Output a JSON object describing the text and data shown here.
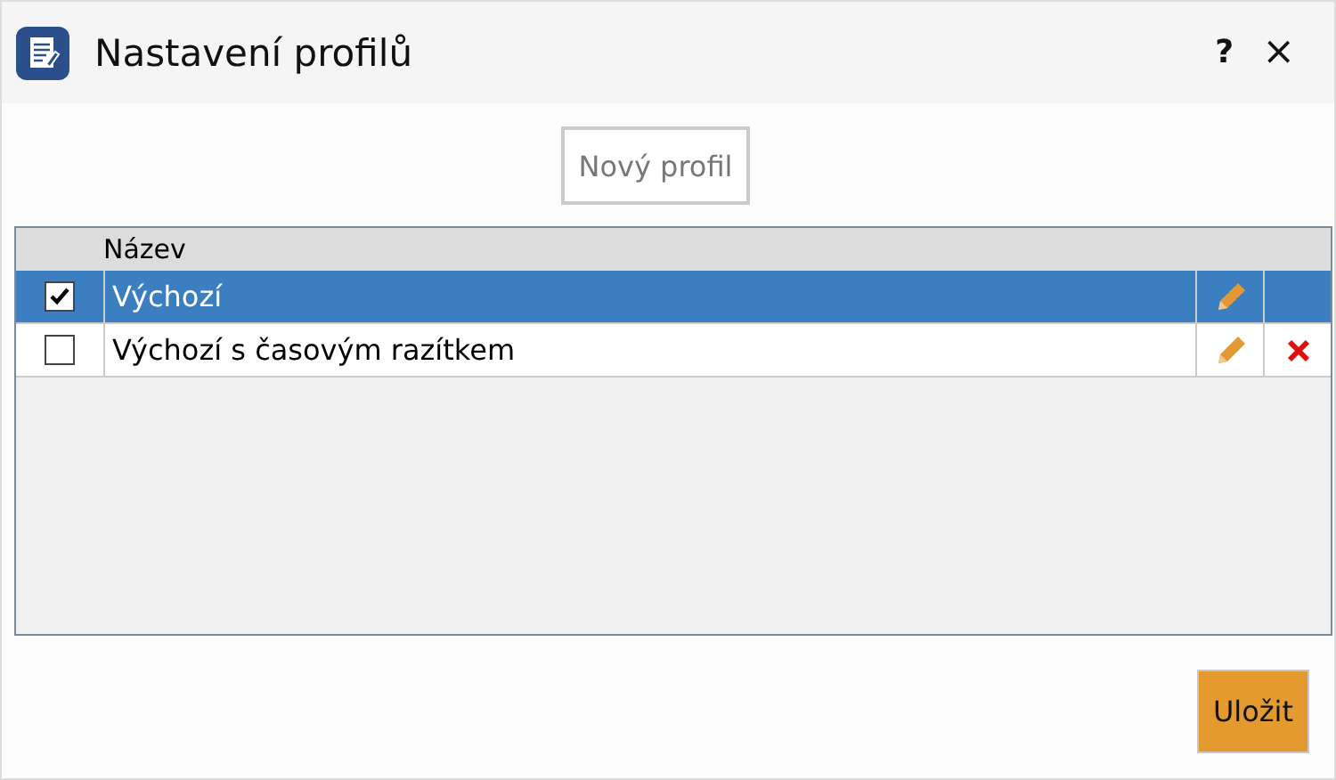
{
  "window": {
    "title": "Nastavení profilů",
    "help": "?",
    "close": "×"
  },
  "new_button": "Nový profil",
  "table": {
    "columns": [
      "Název"
    ],
    "rows": [
      {
        "name": "Výchozí",
        "checked": true,
        "selected": true,
        "deletable": false
      },
      {
        "name": "Výchozí s časovým razítkem",
        "checked": false,
        "selected": false,
        "deletable": true
      }
    ]
  },
  "save_button": "Uložit"
}
